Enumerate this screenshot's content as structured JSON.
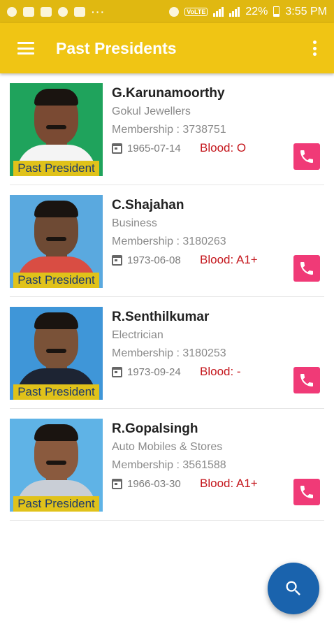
{
  "status_bar": {
    "battery": "22%",
    "time": "3:55 PM",
    "volte": "VoLTE"
  },
  "app_bar": {
    "title": "Past Presidents"
  },
  "members": [
    {
      "name": "G.Karunamoorthy",
      "occupation": "Gokul Jewellers",
      "membership": "Membership : 3738751",
      "dob": "1965-07-14",
      "blood": "Blood: O",
      "tag": "Past President",
      "photo_bg": "#1fa35c",
      "shirt": "#f4f4f4",
      "skin": "#7a4a33"
    },
    {
      "name": "C.Shajahan",
      "occupation": "Business",
      "membership": "Membership : 3180263",
      "dob": "1973-06-08",
      "blood": "Blood: A1+",
      "tag": "Past President",
      "photo_bg": "#5aa9df",
      "shirt": "#d94d43",
      "skin": "#6e4a34"
    },
    {
      "name": "R.Senthilkumar",
      "occupation": "Electrician",
      "membership": "Membership : 3180253",
      "dob": "1973-09-24",
      "blood": "Blood: -",
      "tag": "Past President",
      "photo_bg": "#3f96d8",
      "shirt": "#1d2433",
      "skin": "#7a5238"
    },
    {
      "name": "R.Gopalsingh",
      "occupation": "Auto Mobiles & Stores",
      "membership": "Membership : 3561588",
      "dob": "1966-03-30",
      "blood": "Blood: A1+",
      "tag": "Past President",
      "photo_bg": "#5fb3e6",
      "shirt": "#c9ced6",
      "skin": "#8a5a3e"
    }
  ],
  "colors": {
    "status_bar": "#e0b811",
    "app_bar": "#f0c514",
    "call_button": "#f03a77",
    "fab": "#1a63ad",
    "blood_text": "#c4161c"
  },
  "icons": {
    "menu": "menu-icon",
    "more": "more-vert-icon",
    "call": "phone-icon",
    "date": "calendar-icon",
    "fab": "search-icon"
  }
}
